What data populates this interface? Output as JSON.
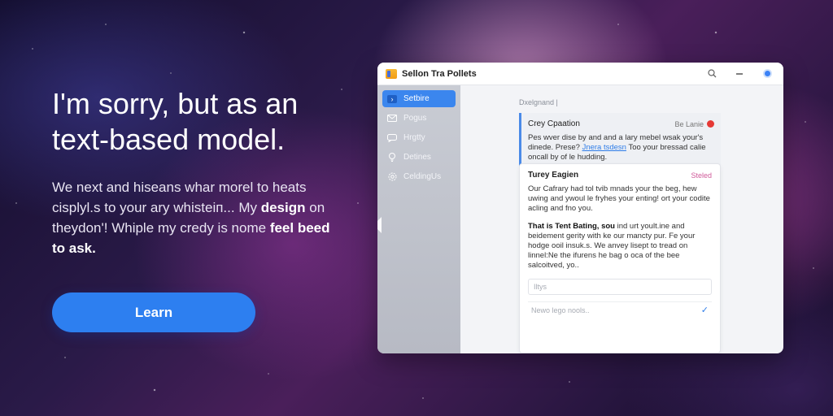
{
  "hero": {
    "title": "I'm sorry, but as an text-based model.",
    "body_1": "We next and hiseans whar morel to heats cisplyl.s to your ary whisteіп... My ",
    "body_bold_1": "design",
    "body_2": " on theydon'! Whiple my credy is nome ",
    "body_bold_2": "feel beed to ask.",
    "learn_button": "Learn",
    "accent_color": "#2d7ff0"
  },
  "window": {
    "title": "Sellon Tra Pollets",
    "icons": [
      "app-folder-icon",
      "search-icon",
      "minimize-icon",
      "close-icon"
    ],
    "sidebar": [
      {
        "label": "Setbire",
        "icon": "terminal-icon",
        "active": true
      },
      {
        "label": "Pogus",
        "icon": "mail-icon",
        "active": false
      },
      {
        "label": "Hrgtty",
        "icon": "chat-icon",
        "active": false
      },
      {
        "label": "Detines",
        "icon": "bulb-icon",
        "active": false
      },
      {
        "label": "CeldingUs",
        "icon": "gear-icon",
        "active": false
      }
    ],
    "breadcrumb": "Dxelgnand |",
    "card_top": {
      "title": "Crey Cpaation",
      "tag": "Be Lanie",
      "text_1": "Pes wver dise by and and a lary mebel wsak your's dinede. Prese?",
      "link": "Jnera tsdesn",
      "text_2": "Too your bressad calie oncall by of le hudding."
    },
    "card_main": {
      "title": "Turey Eagien",
      "tag": "Steled",
      "para_1": "Our Cafrary had tol tvib mnads your the beg, hew uwing and ywoul le fryhes your enting! ort your codite acling and fno you.",
      "para_2_bold": "That is Tent Bating, sou",
      "para_2": " ind urt yoult.ine and beidement gerity with ke our mancty pur. Fe your hodge ooil insuk.s. We anvey lisept to tread on linnel:Ne the ifurens he bag o oca of the bee salcoitved, yo..",
      "field_placeholder": "Iltys",
      "field2_placeholder": "Newo lego nools.."
    }
  }
}
